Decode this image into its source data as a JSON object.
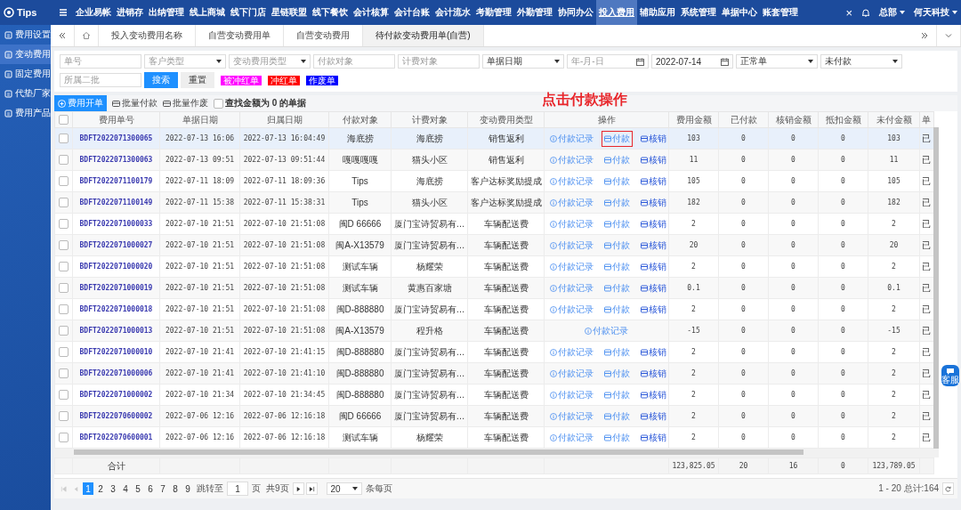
{
  "app": {
    "logo": "Tips",
    "nav": [
      {
        "label": "企业易帐",
        "selected": false
      },
      {
        "label": "进销存",
        "selected": false
      },
      {
        "label": "出纳管理",
        "selected": false
      },
      {
        "label": "线上商城",
        "selected": false
      },
      {
        "label": "线下门店",
        "selected": false
      },
      {
        "label": "星链联盟",
        "selected": false
      },
      {
        "label": "线下餐饮",
        "selected": false
      },
      {
        "label": "会计核算",
        "selected": false
      },
      {
        "label": "会计台账",
        "selected": false
      },
      {
        "label": "会计流水",
        "selected": false
      },
      {
        "label": "考勤管理",
        "selected": false
      },
      {
        "label": "外勤管理",
        "selected": false
      },
      {
        "label": "协同办公",
        "selected": false
      },
      {
        "label": "投入费用",
        "selected": true
      },
      {
        "label": "辅助应用",
        "selected": false
      },
      {
        "label": "系统管理",
        "selected": false
      },
      {
        "label": "单据中心",
        "selected": false
      },
      {
        "label": "账套管理",
        "selected": false
      }
    ],
    "close": "×",
    "branch": "总部",
    "company": "何天科技"
  },
  "sidebar": {
    "items": [
      {
        "label": "费用设置",
        "selected": false
      },
      {
        "label": "变动费用",
        "selected": true
      },
      {
        "label": "固定费用",
        "selected": false
      },
      {
        "label": "代垫厂家",
        "selected": false
      },
      {
        "label": "费用产品",
        "selected": false
      }
    ]
  },
  "tabs": [
    {
      "label": "投入变动费用名称",
      "selected": false
    },
    {
      "label": "自营变动费用单",
      "selected": false
    },
    {
      "label": "自营变动费用",
      "selected": false
    },
    {
      "label": "待付款变动费用单(自营)",
      "selected": true
    }
  ],
  "filters": [
    {
      "kind": "input",
      "placeholder": "单号"
    },
    {
      "kind": "select",
      "placeholder": "客户类型"
    },
    {
      "kind": "select",
      "placeholder": "变动费用类型"
    },
    {
      "kind": "input",
      "placeholder": "付款对象"
    },
    {
      "kind": "input",
      "placeholder": "计费对象"
    },
    {
      "kind": "select",
      "value": "单据日期"
    },
    {
      "kind": "date",
      "placeholder": "年-月-日"
    },
    {
      "kind": "date",
      "value": "2022-07-14"
    },
    {
      "kind": "select",
      "value": "正常单"
    },
    {
      "kind": "select",
      "value": "未付款"
    },
    {
      "kind": "input",
      "placeholder": "所属二批"
    }
  ],
  "search_button": "搜索",
  "reset_button": "重置",
  "legend": [
    {
      "label": "被冲红单",
      "color": "#ff00ff"
    },
    {
      "label": "冲红单",
      "color": "#ff0000"
    },
    {
      "label": "作废单",
      "color": "#0000ff"
    }
  ],
  "toolbar": {
    "create": "费用开单",
    "batch_pay": "批量付款",
    "batch_void": "批量作废",
    "zero_filter": {
      "label": "查找金额为 0 的单据",
      "checked": false
    }
  },
  "annotation": "点击付款操作",
  "table": {
    "header_checked": false,
    "columns": [
      "费用单号",
      "单据日期",
      "归属日期",
      "付款对象",
      "计费对象",
      "变动费用类型",
      "操作",
      "费用金额",
      "已付款",
      "核销金额",
      "抵扣金额",
      "未付金额",
      "单"
    ],
    "rows": [
      {
        "selected": true,
        "checked": false,
        "no": "BDFT2022071300065",
        "date": "2022-07-13 16:06",
        "belong": "2022-07-13 16:04:49",
        "payee": "海底捞",
        "target": "海底捞",
        "type": "销售返利",
        "actions": [
          {
            "kind": "record",
            "label": "付款记录",
            "boxed": false
          },
          {
            "kind": "pay",
            "label": "付款",
            "boxed": true
          },
          {
            "kind": "writeoff",
            "label": "核销",
            "boxed": false
          }
        ],
        "amount": "103",
        "paid": "0",
        "writeoff": "0",
        "deduct": "0",
        "unpaid": "103",
        "status": "已"
      },
      {
        "selected": false,
        "checked": false,
        "no": "BDFT2022071300063",
        "date": "2022-07-13 09:51",
        "belong": "2022-07-13 09:51:44",
        "payee": "嘎嘎嘎嘎",
        "target": "猫头小区",
        "type": "销售返利",
        "actions": [
          {
            "kind": "record",
            "label": "付款记录",
            "boxed": false
          },
          {
            "kind": "pay",
            "label": "付款",
            "boxed": false
          },
          {
            "kind": "writeoff",
            "label": "核销",
            "boxed": false
          }
        ],
        "amount": "11",
        "paid": "0",
        "writeoff": "0",
        "deduct": "0",
        "unpaid": "11",
        "status": "已"
      },
      {
        "selected": false,
        "checked": false,
        "no": "BDFT2022071100179",
        "date": "2022-07-11 18:09",
        "belong": "2022-07-11 18:09:36",
        "payee": "Tips",
        "target": "海底捞",
        "type": "客户达标奖励提成",
        "actions": [
          {
            "kind": "record",
            "label": "付款记录",
            "boxed": false
          },
          {
            "kind": "pay",
            "label": "付款",
            "boxed": false
          },
          {
            "kind": "writeoff",
            "label": "核销",
            "boxed": false
          }
        ],
        "amount": "105",
        "paid": "0",
        "writeoff": "0",
        "deduct": "0",
        "unpaid": "105",
        "status": "已"
      },
      {
        "selected": false,
        "checked": false,
        "no": "BDFT2022071100149",
        "date": "2022-07-11 15:38",
        "belong": "2022-07-11 15:38:31",
        "payee": "Tips",
        "target": "猫头小区",
        "type": "客户达标奖励提成",
        "actions": [
          {
            "kind": "record",
            "label": "付款记录",
            "boxed": false
          },
          {
            "kind": "pay",
            "label": "付款",
            "boxed": false
          },
          {
            "kind": "writeoff",
            "label": "核销",
            "boxed": false
          }
        ],
        "amount": "182",
        "paid": "0",
        "writeoff": "0",
        "deduct": "0",
        "unpaid": "182",
        "status": "已"
      },
      {
        "selected": false,
        "checked": false,
        "no": "BDFT2022071000033",
        "date": "2022-07-10 21:51",
        "belong": "2022-07-10 21:51:08",
        "payee": "闽D 66666",
        "target": "厦门宝诗贸易有…",
        "type": "车辆配送费",
        "actions": [
          {
            "kind": "record",
            "label": "付款记录",
            "boxed": false
          },
          {
            "kind": "pay",
            "label": "付款",
            "boxed": false
          },
          {
            "kind": "writeoff",
            "label": "核销",
            "boxed": false
          }
        ],
        "amount": "2",
        "paid": "0",
        "writeoff": "0",
        "deduct": "0",
        "unpaid": "2",
        "status": "已"
      },
      {
        "selected": false,
        "checked": false,
        "no": "BDFT2022071000027",
        "date": "2022-07-10 21:51",
        "belong": "2022-07-10 21:51:08",
        "payee": "闽A-X13579",
        "target": "厦门宝诗贸易有…",
        "type": "车辆配送费",
        "actions": [
          {
            "kind": "record",
            "label": "付款记录",
            "boxed": false
          },
          {
            "kind": "pay",
            "label": "付款",
            "boxed": false
          },
          {
            "kind": "writeoff",
            "label": "核销",
            "boxed": false
          }
        ],
        "amount": "20",
        "paid": "0",
        "writeoff": "0",
        "deduct": "0",
        "unpaid": "20",
        "status": "已"
      },
      {
        "selected": false,
        "checked": false,
        "no": "BDFT2022071000020",
        "date": "2022-07-10 21:51",
        "belong": "2022-07-10 21:51:08",
        "payee": "测试车辆",
        "target": "杨耀荣",
        "type": "车辆配送费",
        "actions": [
          {
            "kind": "record",
            "label": "付款记录",
            "boxed": false
          },
          {
            "kind": "pay",
            "label": "付款",
            "boxed": false
          },
          {
            "kind": "writeoff",
            "label": "核销",
            "boxed": false
          }
        ],
        "amount": "2",
        "paid": "0",
        "writeoff": "0",
        "deduct": "0",
        "unpaid": "2",
        "status": "已"
      },
      {
        "selected": false,
        "checked": false,
        "no": "BDFT2022071000019",
        "date": "2022-07-10 21:51",
        "belong": "2022-07-10 21:51:08",
        "payee": "测试车辆",
        "target": "黄惠百家塘",
        "type": "车辆配送费",
        "actions": [
          {
            "kind": "record",
            "label": "付款记录",
            "boxed": false
          },
          {
            "kind": "pay",
            "label": "付款",
            "boxed": false
          },
          {
            "kind": "writeoff",
            "label": "核销",
            "boxed": false
          }
        ],
        "amount": "0.1",
        "paid": "0",
        "writeoff": "0",
        "deduct": "0",
        "unpaid": "0.1",
        "status": "已"
      },
      {
        "selected": false,
        "checked": false,
        "no": "BDFT2022071000018",
        "date": "2022-07-10 21:51",
        "belong": "2022-07-10 21:51:08",
        "payee": "闽D-888880",
        "target": "厦门宝诗贸易有…",
        "type": "车辆配送费",
        "actions": [
          {
            "kind": "record",
            "label": "付款记录",
            "boxed": false
          },
          {
            "kind": "pay",
            "label": "付款",
            "boxed": false
          },
          {
            "kind": "writeoff",
            "label": "核销",
            "boxed": false
          }
        ],
        "amount": "2",
        "paid": "0",
        "writeoff": "0",
        "deduct": "0",
        "unpaid": "2",
        "status": "已"
      },
      {
        "selected": false,
        "checked": false,
        "no": "BDFT2022071000013",
        "date": "2022-07-10 21:51",
        "belong": "2022-07-10 21:51:08",
        "payee": "闽A-X13579",
        "target": "程升格",
        "type": "车辆配送费",
        "actions": [
          {
            "kind": "record",
            "label": "付款记录",
            "boxed": false
          }
        ],
        "amount": "-15",
        "paid": "0",
        "writeoff": "0",
        "deduct": "0",
        "unpaid": "-15",
        "status": "已"
      },
      {
        "selected": false,
        "checked": false,
        "no": "BDFT2022071000010",
        "date": "2022-07-10 21:41",
        "belong": "2022-07-10 21:41:15",
        "payee": "闽D-888880",
        "target": "厦门宝诗贸易有…",
        "type": "车辆配送费",
        "actions": [
          {
            "kind": "record",
            "label": "付款记录",
            "boxed": false
          },
          {
            "kind": "pay",
            "label": "付款",
            "boxed": false
          },
          {
            "kind": "writeoff",
            "label": "核销",
            "boxed": false
          }
        ],
        "amount": "2",
        "paid": "0",
        "writeoff": "0",
        "deduct": "0",
        "unpaid": "2",
        "status": "已"
      },
      {
        "selected": false,
        "checked": false,
        "no": "BDFT2022071000006",
        "date": "2022-07-10 21:41",
        "belong": "2022-07-10 21:41:10",
        "payee": "闽D-888880",
        "target": "厦门宝诗贸易有…",
        "type": "车辆配送费",
        "actions": [
          {
            "kind": "record",
            "label": "付款记录",
            "boxed": false
          },
          {
            "kind": "pay",
            "label": "付款",
            "boxed": false
          },
          {
            "kind": "writeoff",
            "label": "核销",
            "boxed": false
          }
        ],
        "amount": "2",
        "paid": "0",
        "writeoff": "0",
        "deduct": "0",
        "unpaid": "2",
        "status": "已"
      },
      {
        "selected": false,
        "checked": false,
        "no": "BDFT2022071000002",
        "date": "2022-07-10 21:34",
        "belong": "2022-07-10 21:34:45",
        "payee": "闽D-888880",
        "target": "厦门宝诗贸易有…",
        "type": "车辆配送费",
        "actions": [
          {
            "kind": "record",
            "label": "付款记录",
            "boxed": false
          },
          {
            "kind": "pay",
            "label": "付款",
            "boxed": false
          },
          {
            "kind": "writeoff",
            "label": "核销",
            "boxed": false
          }
        ],
        "amount": "2",
        "paid": "0",
        "writeoff": "0",
        "deduct": "0",
        "unpaid": "2",
        "status": "已"
      },
      {
        "selected": false,
        "checked": false,
        "no": "BDFT2022070600002",
        "date": "2022-07-06 12:16",
        "belong": "2022-07-06 12:16:18",
        "payee": "闽D 66666",
        "target": "厦门宝诗贸易有…",
        "type": "车辆配送费",
        "actions": [
          {
            "kind": "record",
            "label": "付款记录",
            "boxed": false
          },
          {
            "kind": "pay",
            "label": "付款",
            "boxed": false
          },
          {
            "kind": "writeoff",
            "label": "核销",
            "boxed": false
          }
        ],
        "amount": "2",
        "paid": "0",
        "writeoff": "0",
        "deduct": "0",
        "unpaid": "2",
        "status": "已"
      },
      {
        "selected": false,
        "checked": false,
        "no": "BDFT2022070600001",
        "date": "2022-07-06 12:16",
        "belong": "2022-07-06 12:16:18",
        "payee": "测试车辆",
        "target": "杨耀荣",
        "type": "车辆配送费",
        "actions": [
          {
            "kind": "record",
            "label": "付款记录",
            "boxed": false
          },
          {
            "kind": "pay",
            "label": "付款",
            "boxed": false
          },
          {
            "kind": "writeoff",
            "label": "核销",
            "boxed": false
          }
        ],
        "amount": "2",
        "paid": "0",
        "writeoff": "0",
        "deduct": "0",
        "unpaid": "2",
        "status": "已"
      }
    ],
    "totals": {
      "label": "合计",
      "amount": "123,825.05",
      "paid": "20",
      "writeoff": "16",
      "deduct": "0",
      "unpaid": "123,789.05"
    }
  },
  "pagination": {
    "first_disabled": true,
    "prev_disabled": true,
    "pages": [
      {
        "label": "1",
        "selected": true
      },
      {
        "label": "2",
        "selected": false
      },
      {
        "label": "3",
        "selected": false
      },
      {
        "label": "4",
        "selected": false
      },
      {
        "label": "5",
        "selected": false
      },
      {
        "label": "6",
        "selected": false
      },
      {
        "label": "7",
        "selected": false
      },
      {
        "label": "8",
        "selected": false
      },
      {
        "label": "9",
        "selected": false
      }
    ],
    "jump_label": "跳转至",
    "jump_value": "1",
    "page_unit": "页",
    "page_total": "共9页",
    "page_size": "20",
    "page_size_label": "条每页",
    "summary": "1 - 20 总计:164"
  },
  "chat_badge": "客服"
}
